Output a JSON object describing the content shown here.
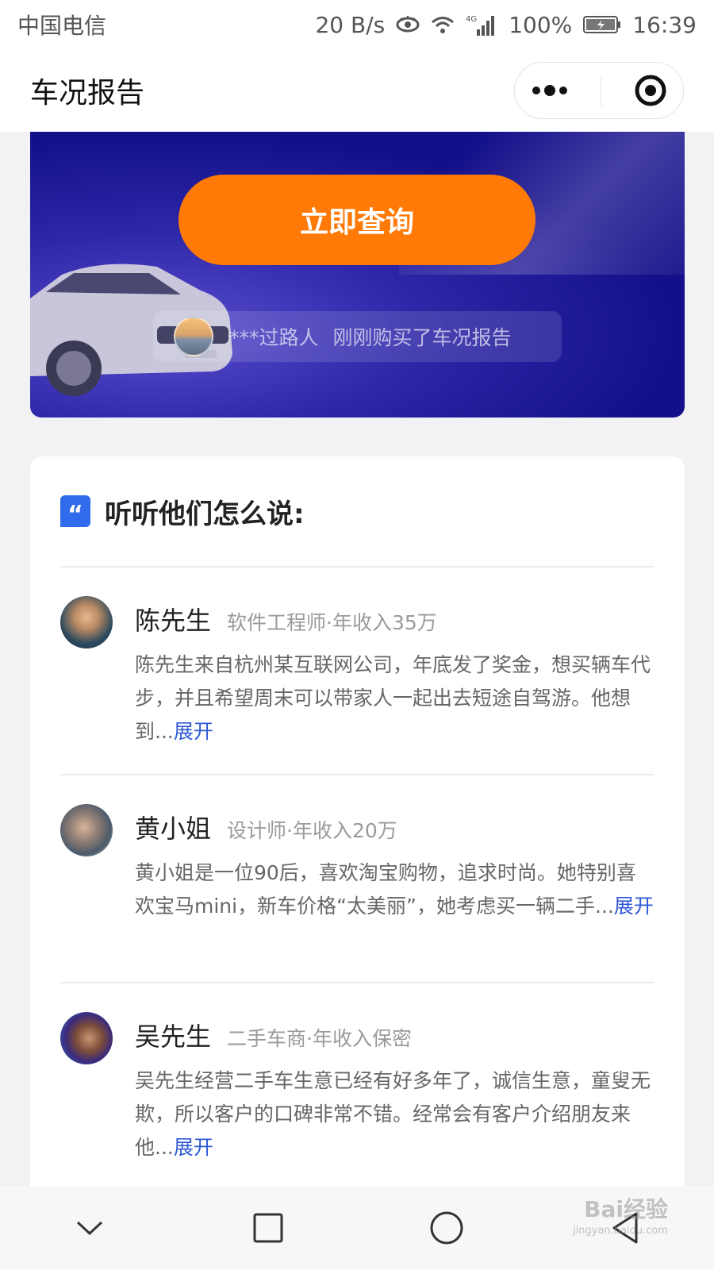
{
  "status_bar": {
    "carrier": "中国电信",
    "net_speed": "20 B/s",
    "network_badge": "4G",
    "battery": "100%",
    "time": "16:39"
  },
  "title_bar": {
    "title": "车况报告",
    "more_icon": "more-dots-icon",
    "close_icon": "target-circle-icon"
  },
  "banner": {
    "button_label": "立即查询",
    "ticker": {
      "user": "***过路人",
      "message": "刚刚购买了车况报告"
    }
  },
  "reviews": {
    "title": "听听他们怎么说:",
    "items": [
      {
        "name": "陈先生",
        "meta": "软件工程师·年收入35万",
        "text": "陈先生来自杭州某互联网公司，年底发了奖金，想买辆车代步，并且希望周末可以带家人一起出去短途自驾游。他想到...",
        "expand": "展开"
      },
      {
        "name": "黄小姐",
        "meta": "设计师·年收入20万",
        "text": "黄小姐是一位90后，喜欢淘宝购物，追求时尚。她特别喜欢宝马mini，新车价格“太美丽”，她考虑买一辆二手...",
        "expand": "展开"
      },
      {
        "name": "吴先生",
        "meta": "二手车商·年收入保密",
        "text": "吴先生经营二手车生意已经有好多年了，诚信生意，童叟无欺，所以客户的口碑非常不错。经常会有客户介绍朋友来他...",
        "expand": "展开"
      }
    ]
  },
  "watermark": {
    "brand": "Bai经验",
    "url": "jingyan.baidu.com"
  },
  "colors": {
    "accent_orange": "#ff7a06",
    "banner_blue": "#14108a",
    "link_blue": "#2f58d6"
  }
}
